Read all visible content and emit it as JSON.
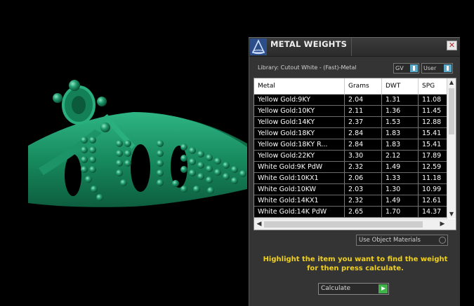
{
  "window": {
    "title": "METAL WEIGHTS",
    "close_label": "✕"
  },
  "library": {
    "label": "Library: Cutout White - (Fast)-Metal"
  },
  "toggles": {
    "gv_label": "GV",
    "user_label": "User"
  },
  "table": {
    "columns": [
      "Metal",
      "Grams",
      "DWT",
      "SPG"
    ],
    "rows": [
      [
        "Yellow Gold:9KY",
        "2.04",
        "1.31",
        "11.08"
      ],
      [
        "Yellow Gold:10KY",
        "2.11",
        "1.36",
        "11.45"
      ],
      [
        "Yellow Gold:14KY",
        "2.37",
        "1.53",
        "12.88"
      ],
      [
        "Yellow Gold:18KY",
        "2.84",
        "1.83",
        "15.41"
      ],
      [
        "Yellow Gold:18KY R...",
        "2.84",
        "1.83",
        "15.41"
      ],
      [
        "Yellow Gold:22KY",
        "3.30",
        "2.12",
        "17.89"
      ],
      [
        "White Gold:9K PdW",
        "2.32",
        "1.49",
        "12.59"
      ],
      [
        "White Gold:10KX1",
        "2.06",
        "1.33",
        "11.18"
      ],
      [
        "White Gold:10KW",
        "2.03",
        "1.30",
        "10.99"
      ],
      [
        "White Gold:14KX1",
        "2.32",
        "1.49",
        "12.61"
      ],
      [
        "White Gold:14K PdW",
        "2.65",
        "1.70",
        "14.37"
      ]
    ],
    "vscroll_fraction": 0.35
  },
  "use_object_materials": {
    "label": "Use Object Materials"
  },
  "hint": {
    "text": "Highlight the item you want to find the weight for then press calculate."
  },
  "calculate": {
    "label": "Calculate"
  },
  "colors": {
    "ring": "#1f9a6e",
    "hint": "#f0d020",
    "indicator_blue": "#5aa9c8",
    "play_green": "#3fb34a"
  }
}
